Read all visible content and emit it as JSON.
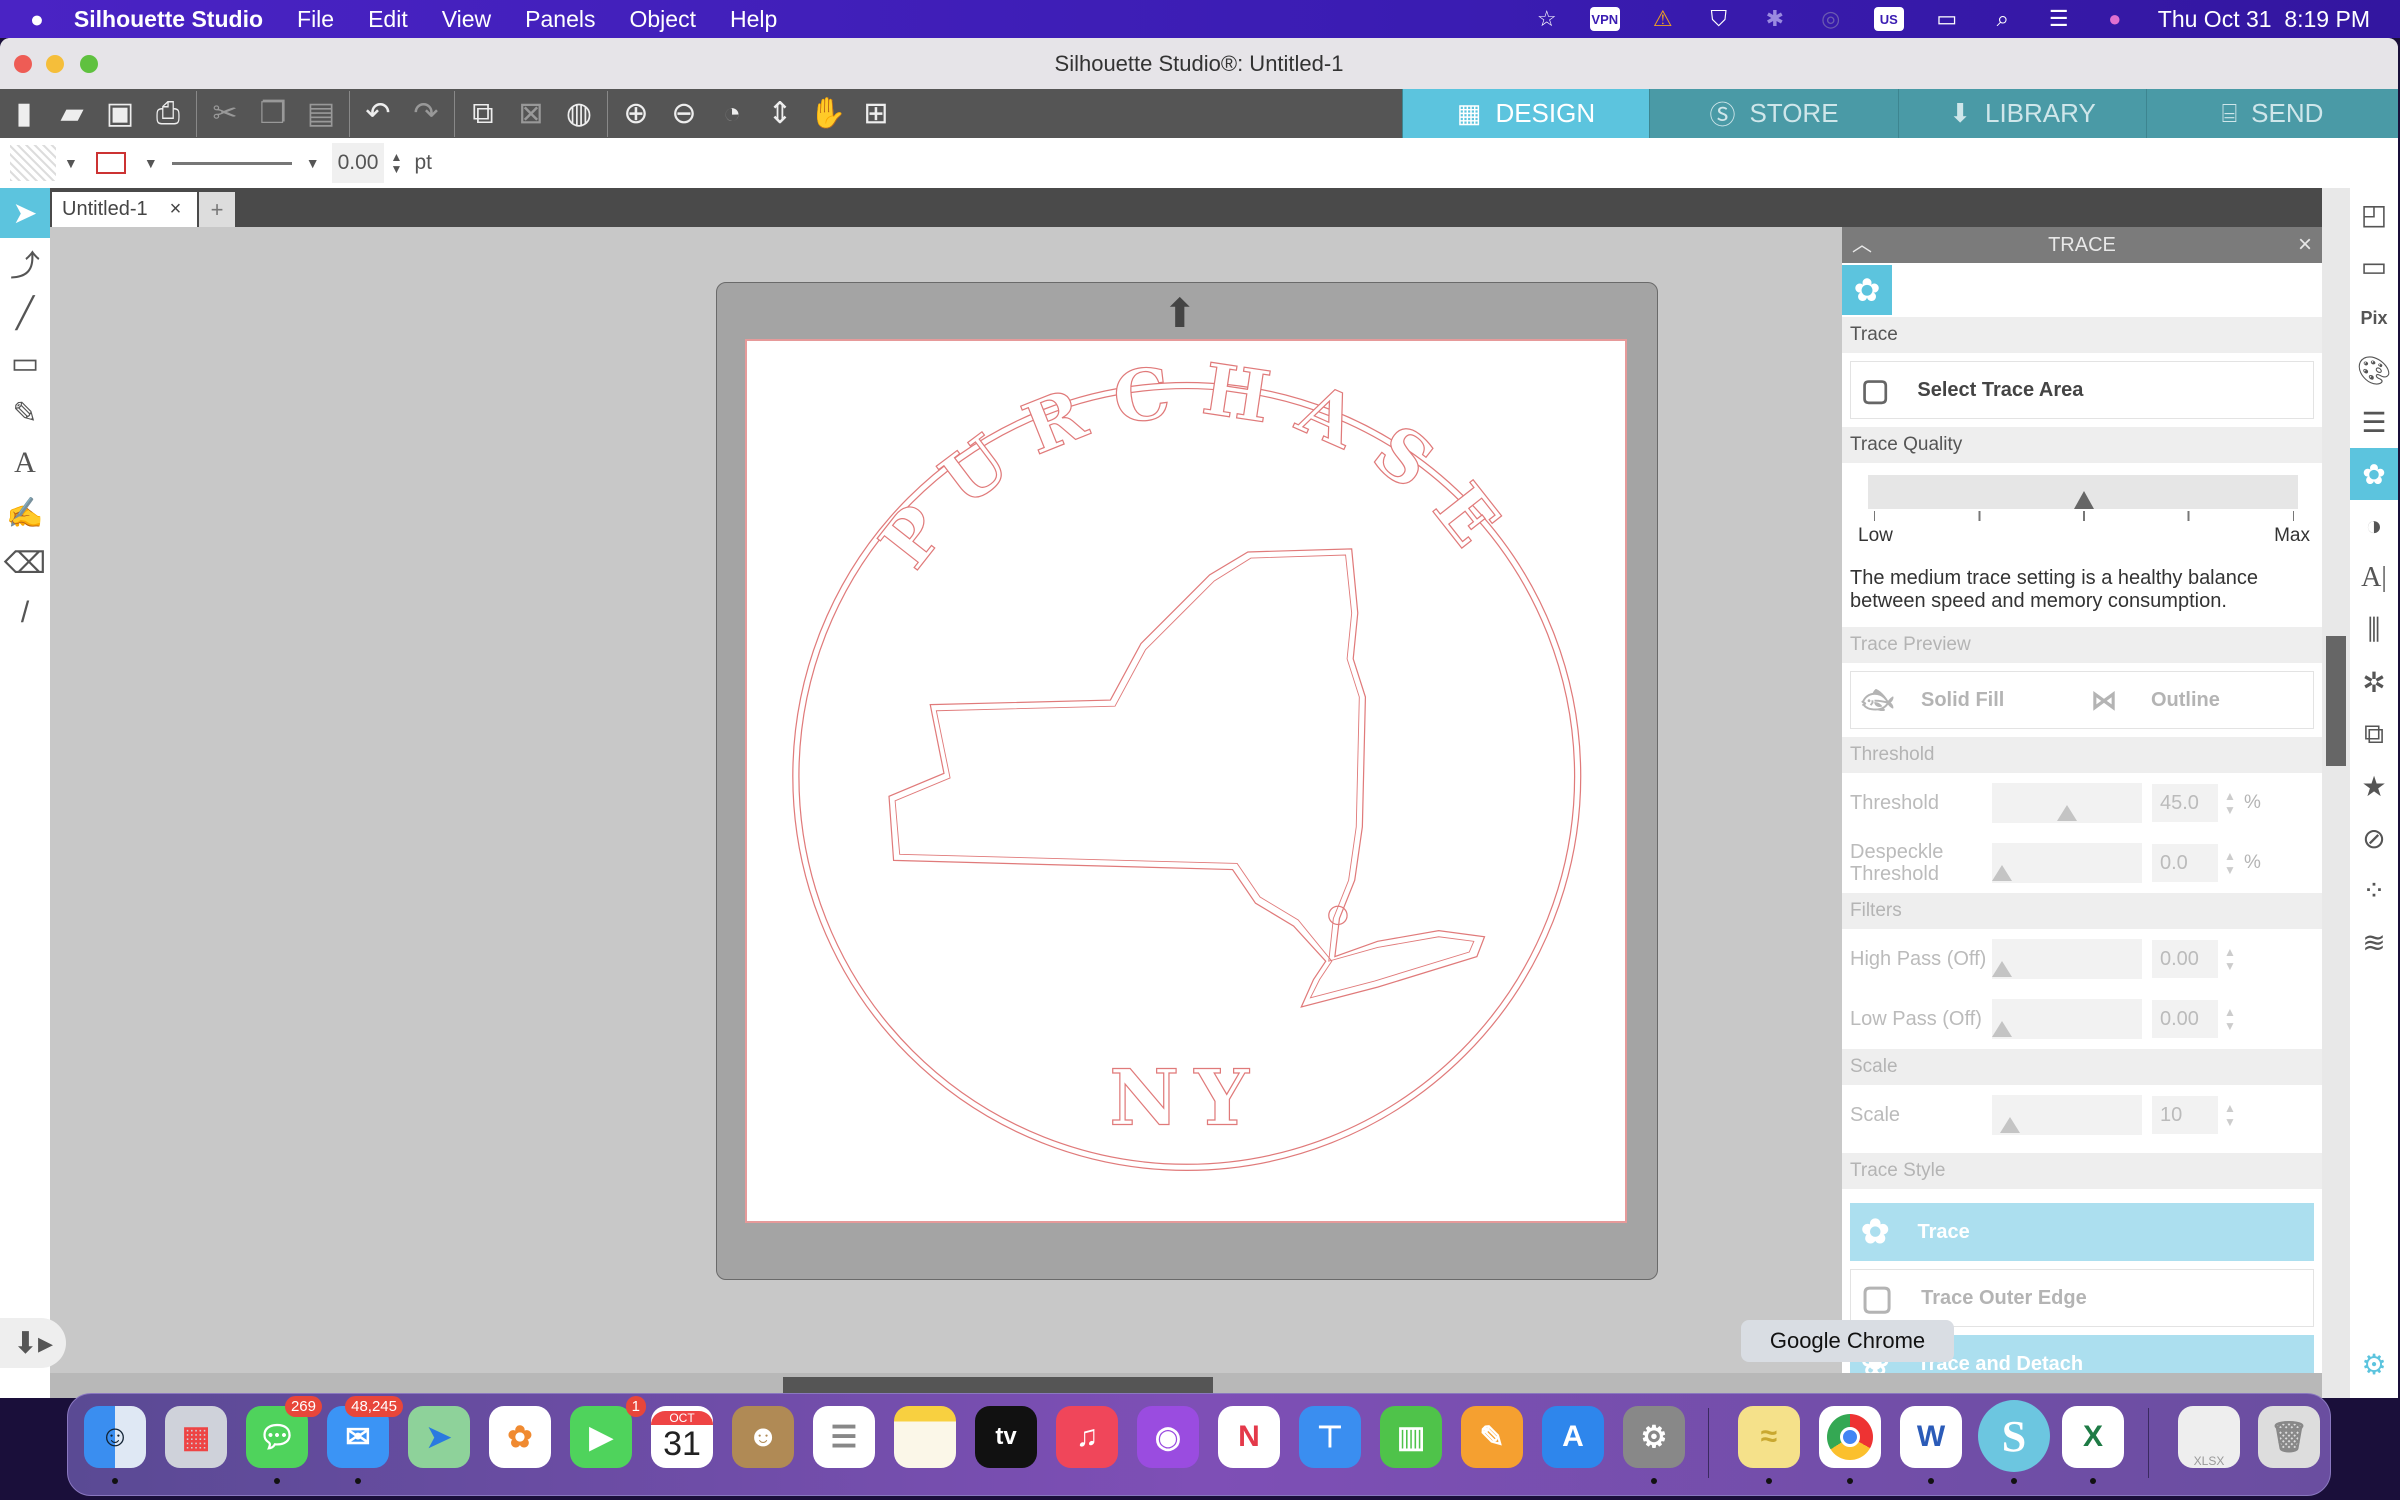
{
  "menubar": {
    "app": "Silhouette Studio",
    "items": [
      "File",
      "Edit",
      "View",
      "Panels",
      "Object",
      "Help"
    ],
    "status_icons": [
      "star-icon",
      "vpn-icon",
      "warning-shield-icon",
      "shield-check-icon",
      "bluetooth-icon",
      "airdrop-icon",
      "input-source-icon",
      "battery-icon",
      "spotlight-icon",
      "control-center-icon",
      "siri-icon"
    ],
    "vpn": "VPN",
    "input_source": "US",
    "clock": "Thu Oct 31  8:19 PM"
  },
  "window": {
    "title": "Silhouette Studio®: Untitled-1"
  },
  "nav_tabs": [
    {
      "label": "DESIGN",
      "active": true
    },
    {
      "label": "STORE"
    },
    {
      "label": "LIBRARY"
    },
    {
      "label": "SEND"
    }
  ],
  "propbar": {
    "line_width": "0.00",
    "unit": "pt"
  },
  "doc_tab": {
    "label": "Untitled-1",
    "close": "×",
    "add": "+"
  },
  "design": {
    "arc_text": "PURCHASE",
    "bottom_text": "NY",
    "line_color": "#e07a7a"
  },
  "trace_panel": {
    "title": "TRACE",
    "close": "×",
    "section_trace": "Trace",
    "select_area": "Select Trace Area",
    "section_quality": "Trace Quality",
    "quality_low": "Low",
    "quality_max": "Max",
    "quality_level": 0.5,
    "description": "The medium trace setting is a healthy balance between speed and memory consumption.",
    "section_preview": "Trace Preview",
    "solid_fill": "Solid Fill",
    "outline": "Outline",
    "section_threshold": "Threshold",
    "threshold_label": "Threshold",
    "threshold_value": "45.0",
    "despeckle_label": "Despeckle Threshold",
    "despeckle_value": "0.0",
    "percent": "%",
    "section_filters": "Filters",
    "high_pass_label": "High Pass (Off)",
    "high_pass_value": "0.00",
    "low_pass_label": "Low Pass (Off)",
    "low_pass_value": "0.00",
    "section_scale": "Scale",
    "scale_label": "Scale",
    "scale_value": "10",
    "section_style": "Trace Style",
    "style_trace": "Trace",
    "style_outer": "Trace Outer Edge",
    "style_detach": "Trace and Detach",
    "accent": "#5cc4de"
  },
  "dock": {
    "badges": {
      "messages": "269",
      "mail": "48,245",
      "facetime": "1"
    },
    "calendar_month": "OCT",
    "calendar_day": "31",
    "tv": "tv",
    "xlsx": "XLSX",
    "tooltip": "Google Chrome"
  }
}
